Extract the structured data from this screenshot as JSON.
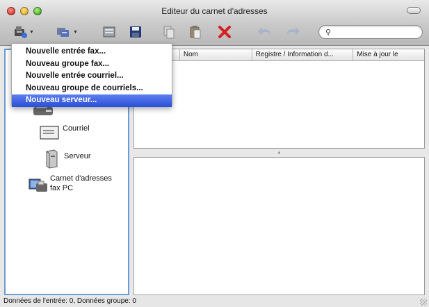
{
  "window": {
    "title": "Editeur du carnet d'adresses"
  },
  "toolbar": {
    "buttons": [
      "new-entry-icon",
      "new-group-icon",
      "properties-icon",
      "save-icon",
      "copy-icon",
      "paste-icon",
      "delete-icon",
      "undo-icon",
      "redo-icon"
    ],
    "search": {
      "placeholder": "",
      "value": ""
    }
  },
  "menu": {
    "items": [
      {
        "label": "Nouvelle entrée fax...",
        "selected": false
      },
      {
        "label": "Nouveau groupe fax...",
        "selected": false
      },
      {
        "label": "Nouvelle entrée courriel...",
        "selected": false
      },
      {
        "label": "Nouveau groupe de courriels...",
        "selected": false
      },
      {
        "label": "Nouveau serveur...",
        "selected": true
      }
    ]
  },
  "sidebar": {
    "fax_partial": "Fax",
    "courriel": "Courriel",
    "serveur": "Serveur",
    "carnet_line1": "Carnet d'adresses",
    "carnet_line2": "fax PC"
  },
  "table": {
    "columns": [
      "",
      "Nom",
      "Registre / Information d...",
      "Mise à jour le"
    ]
  },
  "status": {
    "text": "Données de l'entrée: 0, Données groupe: 0"
  },
  "colors": {
    "selection": "#2a4fd8",
    "pane_focus_border": "#6a9bd4",
    "delete_red": "#d42020"
  }
}
